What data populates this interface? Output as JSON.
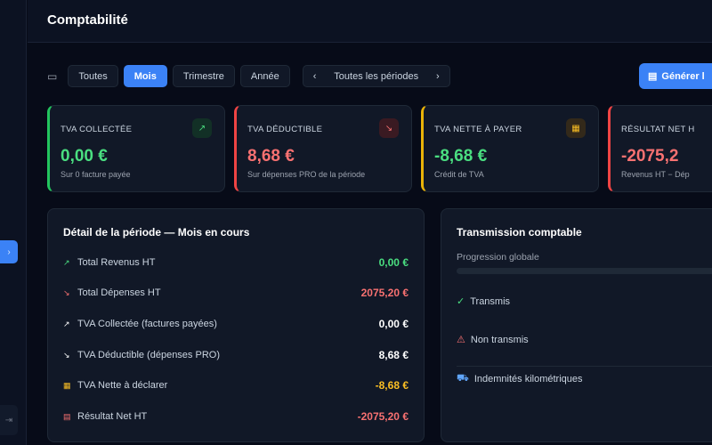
{
  "header": {
    "title": "Comptabilité"
  },
  "filters": {
    "items": [
      {
        "label": "Toutes",
        "active": false
      },
      {
        "label": "Mois",
        "active": true
      },
      {
        "label": "Trimestre",
        "active": false
      },
      {
        "label": "Année",
        "active": false
      }
    ],
    "period": "Toutes les périodes",
    "prev": "‹",
    "next": "›"
  },
  "generate": {
    "label": "Générer l"
  },
  "sidebar": {
    "expand": "›",
    "logout": "⇥"
  },
  "cards": [
    {
      "label": "TVA COLLECTÉE",
      "value": "0,00 €",
      "sub": "Sur 0 facture payée",
      "color": "#4ade80",
      "icon": "trending-up"
    },
    {
      "label": "TVA DÉDUCTIBLE",
      "value": "8,68 €",
      "sub": "Sur dépenses PRO de la période",
      "color": "#f87171",
      "icon": "trending-down"
    },
    {
      "label": "TVA NETTE À PAYER",
      "value": "-8,68 €",
      "sub": "Crédit de TVA",
      "color": "#4ade80",
      "border": "#eab308",
      "icon": "calculator"
    },
    {
      "label": "RÉSULTAT NET H",
      "value": "-2075,2",
      "sub": "Revenus HT − Dép",
      "color": "#f87171",
      "icon": "receipt"
    }
  ],
  "detail": {
    "title": "Détail de la période — Mois en cours",
    "rows": [
      {
        "label": "Total Revenus HT",
        "value": "0,00 €",
        "color": "#4ade80",
        "icon": "trending-up"
      },
      {
        "label": "Total Dépenses HT",
        "value": "2075,20 €",
        "color": "#f87171",
        "icon": "trending-down"
      },
      {
        "label": "TVA Collectée (factures payées)",
        "value": "0,00 €",
        "color": "#ffffff",
        "icon": "trending-up"
      },
      {
        "label": "TVA Déductible (dépenses PRO)",
        "value": "8,68 €",
        "color": "#ffffff",
        "icon": "trending-down"
      },
      {
        "label": "TVA Nette à déclarer",
        "value": "-8,68 €",
        "color": "#fbbf24",
        "icon": "calculator"
      },
      {
        "label": "Résultat Net HT",
        "value": "-2075,20 €",
        "color": "#f87171",
        "icon": "receipt"
      }
    ]
  },
  "transmission": {
    "title": "Transmission comptable",
    "progress_label": "Progression globale",
    "progress": 0,
    "transmitted": "Transmis",
    "not_transmitted": "Non transmis",
    "mileage": "Indemnités kilométriques"
  }
}
